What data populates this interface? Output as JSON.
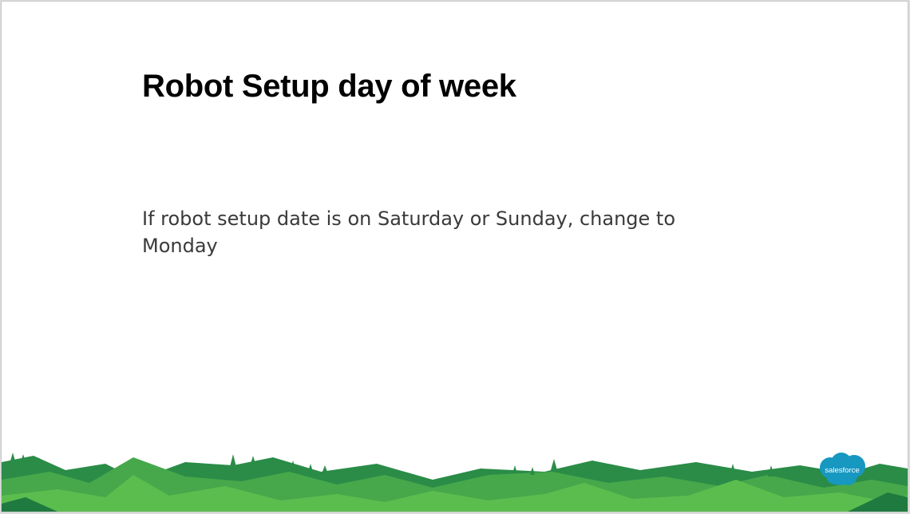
{
  "slide": {
    "title": "Robot Setup day of week",
    "body": "If robot setup date is on Saturday or Sunday, change to Monday"
  },
  "logo": {
    "text": "salesforce",
    "color": "#1798c1"
  },
  "colors": {
    "light_green": "#5bbd4e",
    "mid_green": "#46a84a",
    "dark_green": "#2a8c47",
    "darkest_green": "#1f7a3f"
  }
}
